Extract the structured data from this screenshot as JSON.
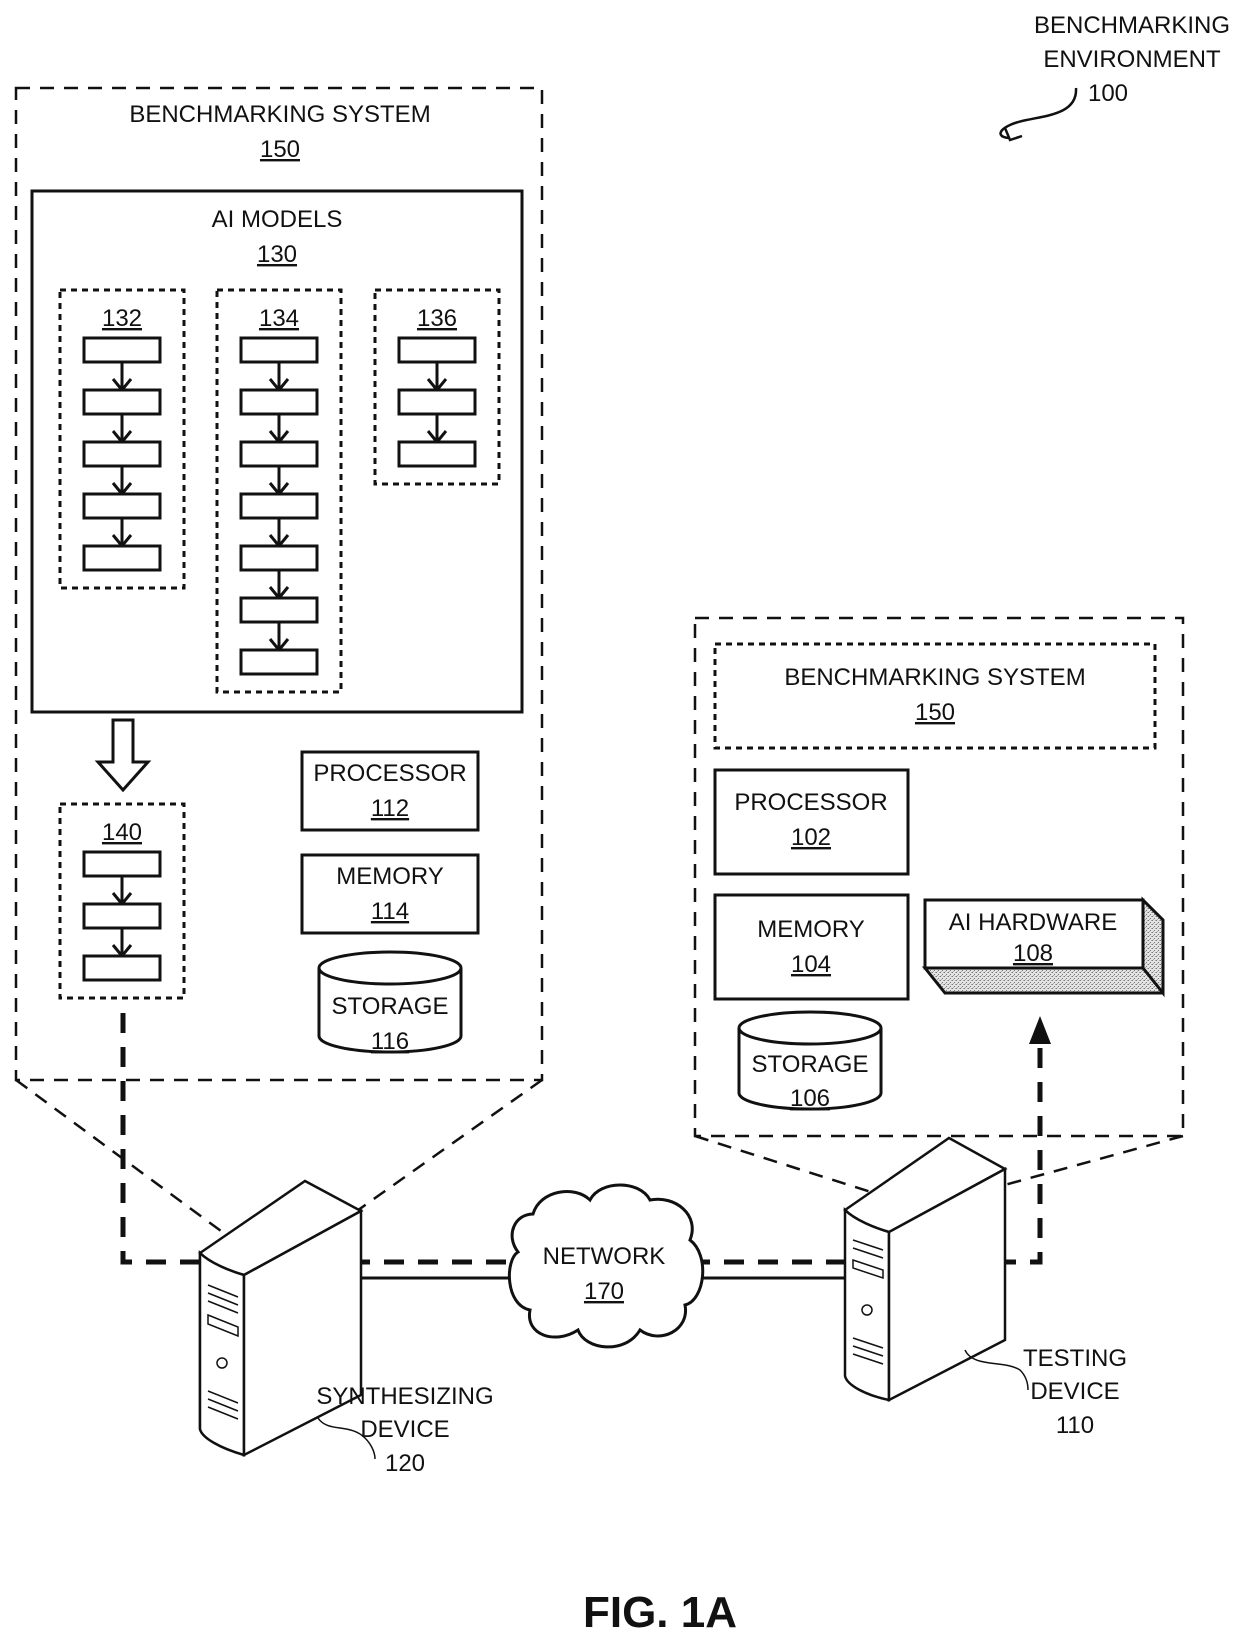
{
  "environment": {
    "title_line1": "BENCHMARKING",
    "title_line2": "ENVIRONMENT",
    "ref": "100"
  },
  "synth_panel": {
    "system_label": "BENCHMARKING SYSTEM",
    "system_ref": "150",
    "ai_models": {
      "label": "AI MODELS",
      "ref": "130",
      "models": [
        {
          "ref": "132",
          "layers": 5
        },
        {
          "ref": "134",
          "layers": 7
        },
        {
          "ref": "136",
          "layers": 3
        }
      ]
    },
    "synthesized_model": {
      "ref": "140",
      "layers": 3
    },
    "processor": {
      "label": "PROCESSOR",
      "ref": "112"
    },
    "memory": {
      "label": "MEMORY",
      "ref": "114"
    },
    "storage": {
      "label": "STORAGE",
      "ref": "116"
    }
  },
  "test_panel": {
    "system_label": "BENCHMARKING SYSTEM",
    "system_ref": "150",
    "processor": {
      "label": "PROCESSOR",
      "ref": "102"
    },
    "memory": {
      "label": "MEMORY",
      "ref": "104"
    },
    "storage": {
      "label": "STORAGE",
      "ref": "106"
    },
    "ai_hardware": {
      "label": "AI HARDWARE",
      "ref": "108"
    }
  },
  "network": {
    "label": "NETWORK",
    "ref": "170"
  },
  "synthesizing_device": {
    "line1": "SYNTHESIZING",
    "line2": "DEVICE",
    "ref": "120"
  },
  "testing_device": {
    "line1": "TESTING",
    "line2": "DEVICE",
    "ref": "110"
  },
  "figure_label": "FIG. 1A"
}
